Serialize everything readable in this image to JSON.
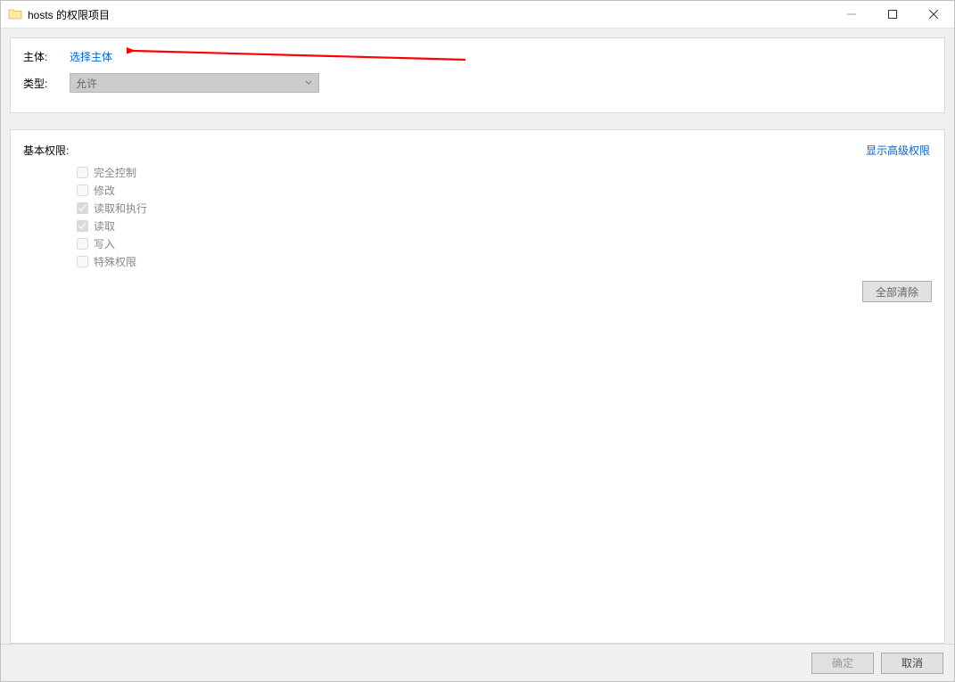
{
  "window": {
    "title": "hosts 的权限项目"
  },
  "principal": {
    "label": "主体:",
    "select_link": "选择主体"
  },
  "type": {
    "label": "类型:",
    "value": "允许"
  },
  "permissions": {
    "title": "基本权限:",
    "advanced_link": "显示高级权限",
    "items": [
      {
        "label": "完全控制",
        "checked": false
      },
      {
        "label": "修改",
        "checked": false
      },
      {
        "label": "读取和执行",
        "checked": true
      },
      {
        "label": "读取",
        "checked": true
      },
      {
        "label": "写入",
        "checked": false
      },
      {
        "label": "特殊权限",
        "checked": false
      }
    ],
    "clear_all": "全部清除"
  },
  "footer": {
    "ok": "确定",
    "cancel": "取消"
  }
}
